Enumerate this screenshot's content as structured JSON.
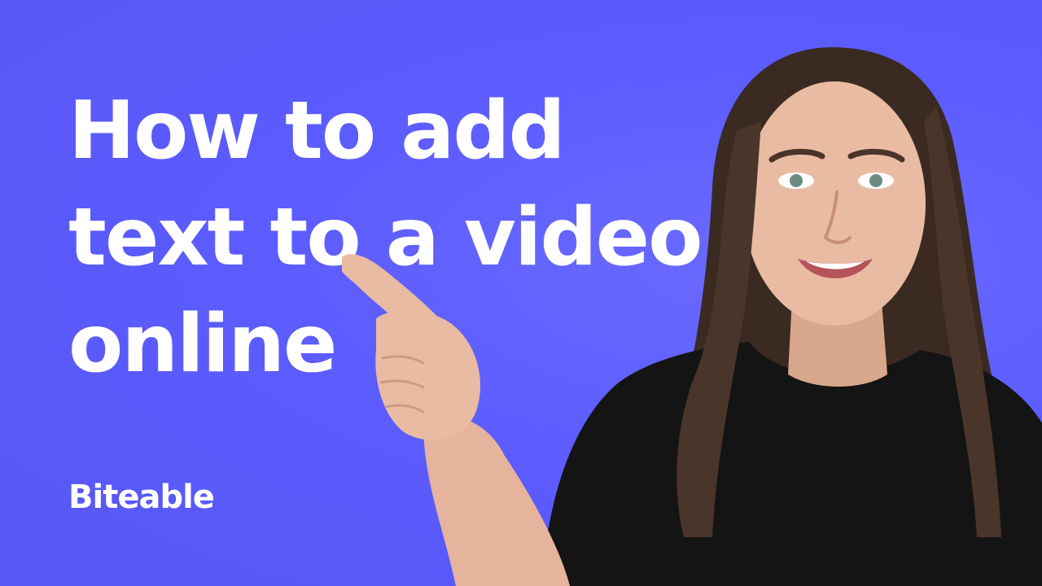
{
  "headline": {
    "lines": [
      "How to add",
      "text to a video",
      "online"
    ]
  },
  "brand": {
    "logo_text": "Biteable"
  },
  "colors": {
    "background": "#5c5cff",
    "text": "#ffffff",
    "shirt": "#111111",
    "hair": "#3a2a22",
    "skin": "#e9bba3"
  },
  "photo": {
    "subject": "woman-pointing-at-headline"
  }
}
